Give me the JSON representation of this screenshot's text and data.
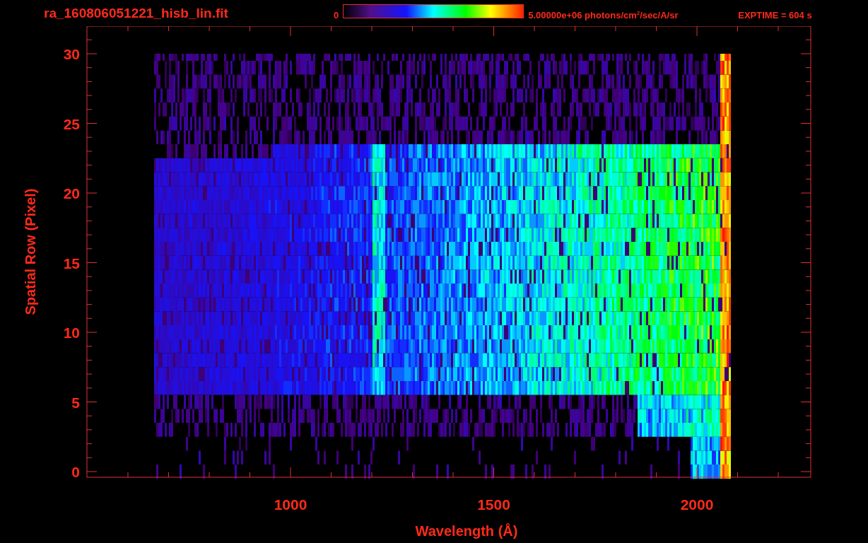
{
  "header": {
    "file_name": "ra_160806051221_hisb_lin.fit",
    "colorbar": {
      "min_label": "0",
      "max_label": "5.00000e+06 photons/cm$^{2}$/sec/A/sr"
    },
    "exposure": "EXPTIME = 604 s"
  },
  "plot": {
    "x_axis": {
      "label": "Wavelength (Å)",
      "ticks": [
        "1000",
        "1500",
        "2000"
      ]
    },
    "y_axis": {
      "label": "Spatial Row (Pixel)",
      "ticks": [
        "30",
        "25",
        "20",
        "15",
        "10",
        "5",
        "0"
      ]
    }
  }
}
